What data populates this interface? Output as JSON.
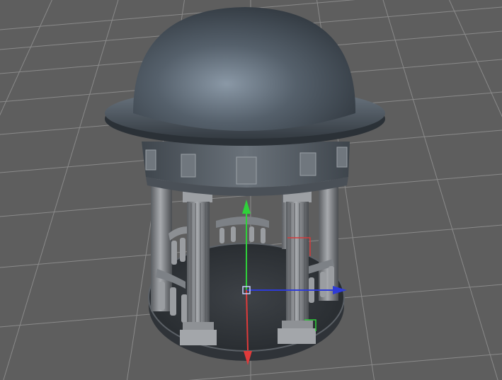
{
  "viewport": {
    "background": "#5e5e5e",
    "grid_color": "#8a8a8a",
    "grid_visible": true
  },
  "model": {
    "icon": "gazebo-rotunda-model-icon",
    "dome_color": "#4b5560",
    "body_color": "#5b6168",
    "stone_color": "#8c8f93"
  },
  "gizmo": {
    "icon": "move-gizmo-icon",
    "x_axis_color": "#2e3bd6",
    "y_axis_color": "#2fd13a",
    "z_axis_color": "#e03a3a",
    "rotation_hint_color": "#d43a3a"
  }
}
